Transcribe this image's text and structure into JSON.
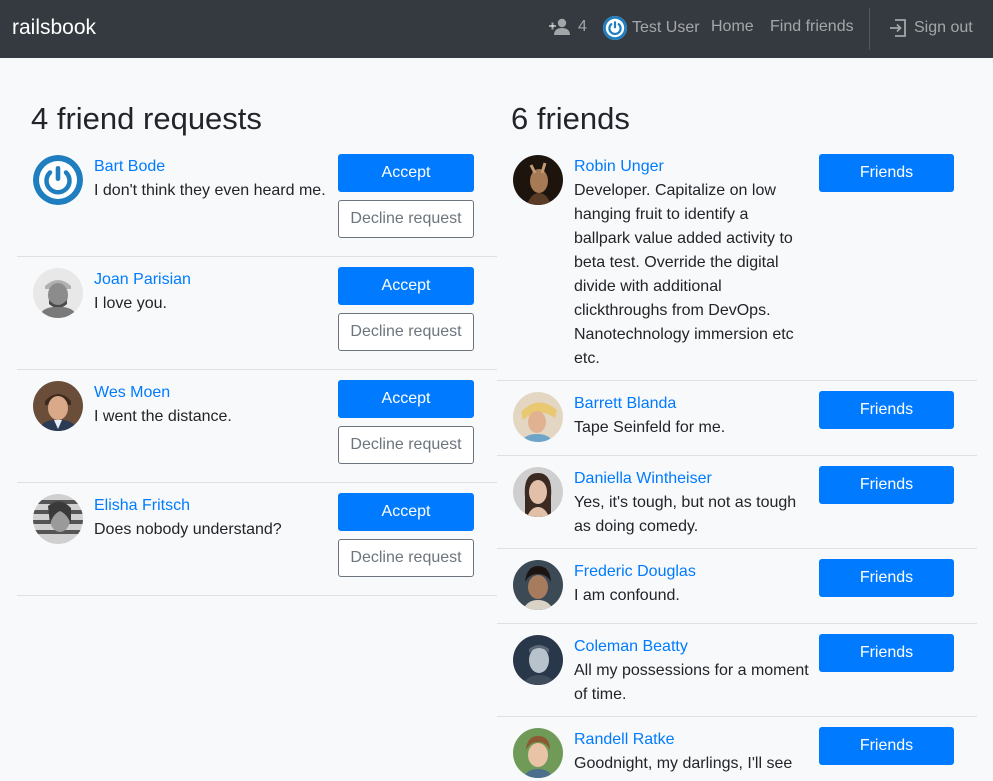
{
  "navbar": {
    "brand": "railsbook",
    "request_count": "4",
    "user_name": "Test User",
    "home": "Home",
    "find_friends": "Find friends",
    "sign_out": "Sign out"
  },
  "requests": {
    "heading": "4 friend requests",
    "accept_label": "Accept",
    "decline_label": "Decline request",
    "items": [
      {
        "name": "Bart Bode",
        "message": "I don't think they even heard me."
      },
      {
        "name": "Joan Parisian",
        "message": "I love you."
      },
      {
        "name": "Wes Moen",
        "message": "I went the distance."
      },
      {
        "name": "Elisha Fritsch",
        "message": "Does nobody understand?"
      }
    ]
  },
  "friends": {
    "heading": "6 friends",
    "button_label": "Friends",
    "items": [
      {
        "name": "Robin Unger",
        "message": "Developer. Capitalize on low hanging fruit to identify a ballpark value added activity to beta test. Override the digital divide with additional clickthroughs from DevOps. Nanotechnology immersion etc etc."
      },
      {
        "name": "Barrett Blanda",
        "message": "Tape Seinfeld for me."
      },
      {
        "name": "Daniella Wintheiser",
        "message": "Yes, it's tough, but not as tough as doing comedy."
      },
      {
        "name": "Frederic Douglas",
        "message": "I am confound."
      },
      {
        "name": "Coleman Beatty",
        "message": "All my possessions for a moment of time."
      },
      {
        "name": "Randell Ratke",
        "message": "Goodnight, my darlings, I'll see"
      }
    ]
  },
  "colors": {
    "navbar": "#343a40",
    "primary": "#007bff",
    "secondary": "#6c757d",
    "background": "#f8f9fa"
  }
}
